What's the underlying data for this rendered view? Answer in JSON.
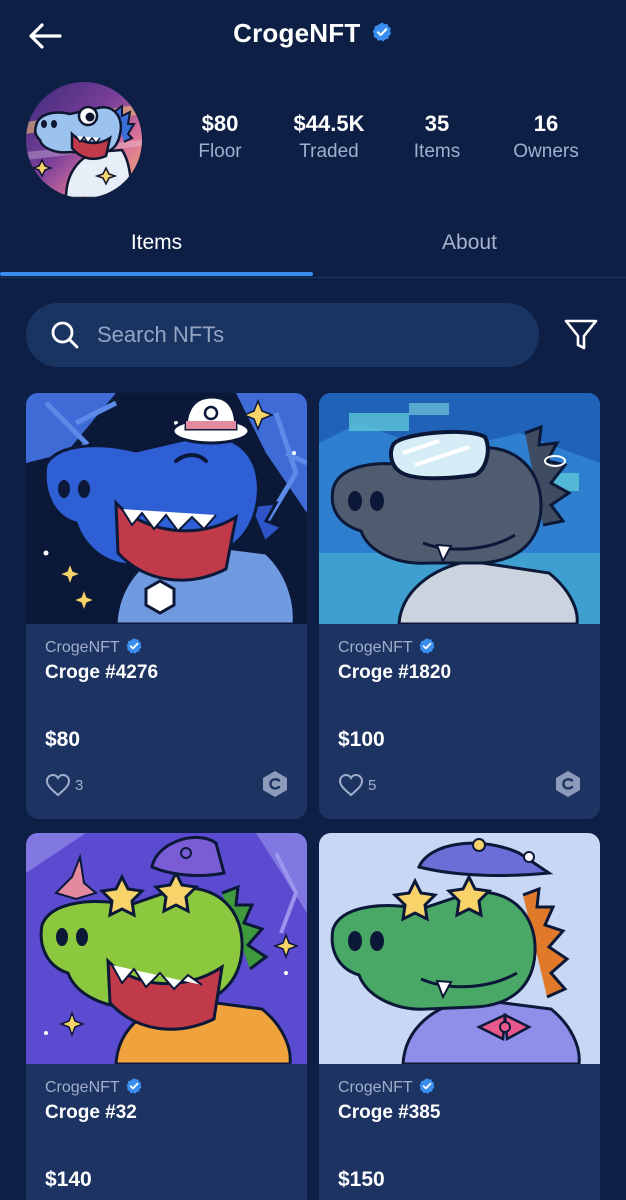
{
  "header": {
    "title": "CrogeNFT",
    "verified": true
  },
  "stats": [
    {
      "value": "$80",
      "label": "Floor"
    },
    {
      "value": "$44.5K",
      "label": "Traded"
    },
    {
      "value": "35",
      "label": "Items"
    },
    {
      "value": "16",
      "label": "Owners"
    }
  ],
  "tabs": [
    {
      "label": "Items",
      "active": true
    },
    {
      "label": "About",
      "active": false
    }
  ],
  "search": {
    "placeholder": "Search NFTs"
  },
  "cards": [
    {
      "collection": "CrogeNFT",
      "name": "Croge #4276",
      "price": "$80",
      "likes": "3"
    },
    {
      "collection": "CrogeNFT",
      "name": "Croge #1820",
      "price": "$100",
      "likes": "5"
    },
    {
      "collection": "CrogeNFT",
      "name": "Croge #32",
      "price": "$140"
    },
    {
      "collection": "CrogeNFT",
      "name": "Croge #385",
      "price": "$150"
    }
  ],
  "colors": {
    "background": "#0d1f45",
    "card": "#1d3462",
    "accent": "#3a8ef0",
    "muted_text": "#9fb0cf"
  },
  "icons": [
    "back-arrow-icon",
    "verified-icon",
    "search-icon",
    "filter-icon",
    "heart-icon",
    "cronos-chain-icon"
  ]
}
